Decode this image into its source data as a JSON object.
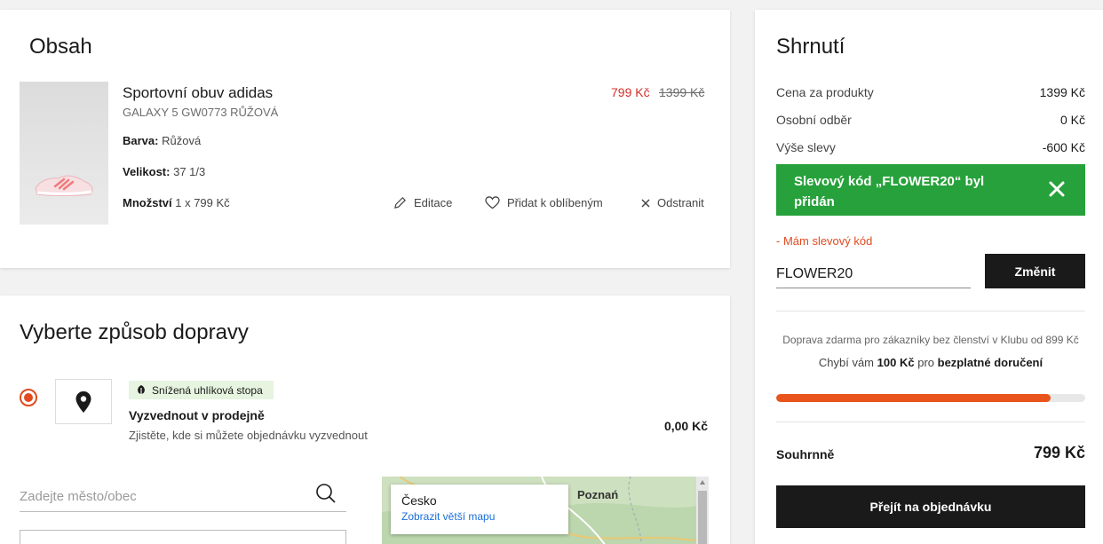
{
  "cart": {
    "title": "Obsah",
    "item": {
      "name": "Sportovní obuv adidas",
      "subtitle": "GALAXY 5 GW0773 RŮŽOVÁ",
      "color_label": "Barva:",
      "color_value": "Růžová",
      "size_label": "Velikost:",
      "size_value": "37 1/3",
      "qty_label": "Množství",
      "qty_value": "1 x 799 Kč",
      "price_new": "799 Kč",
      "price_old": "1399 Kč",
      "edit_label": "Editace",
      "favorite_label": "Přidat k oblíbeným",
      "remove_label": "Odstranit"
    }
  },
  "delivery": {
    "title": "Vyberte způsob dopravy",
    "option": {
      "badge": "Snížená uhlíková stopa",
      "name": "Vyzvednout v prodejně",
      "description": "Zjistěte, kde si můžete objednávku vyzvednout",
      "price": "0,00 Kč"
    },
    "search_placeholder": "Zadejte město/obec",
    "map": {
      "popup_title": "Česko",
      "popup_link": "Zobrazit větší mapu",
      "city_labels": [
        "Poznań"
      ]
    }
  },
  "summary": {
    "title": "Shrnutí",
    "rows": [
      {
        "label": "Cena za produkty",
        "value": "1399 Kč"
      },
      {
        "label": "Osobní odběr",
        "value": "0 Kč"
      },
      {
        "label": "Výše slevy",
        "value": "-600 Kč"
      }
    ],
    "promo_applied": "Slevový kód „FLOWER20“ byl přidán",
    "have_code_label": "- Mám slevový kód",
    "code_value": "FLOWER20",
    "change_button": "Změnit",
    "shipping_note": "Doprava zdarma pro zákazníky bez členství v Klubu od 899 Kč",
    "missing_prefix": "Chybí vám",
    "missing_amount": "100",
    "missing_currency": "Kč",
    "missing_mid": "pro",
    "missing_suffix": "bezplatné doručení",
    "progress_fraction": 0.889,
    "total_label": "Souhrnně",
    "total_value": "799 Kč",
    "checkout_button": "Přejít na objednávku"
  },
  "colors": {
    "accent_orange": "#e14a1f",
    "success_green": "#27a13b",
    "price_red": "#d0302a",
    "dark_button": "#1a1a1a"
  },
  "icons": [
    "pencil-icon",
    "heart-icon",
    "close-icon",
    "location-pin-icon",
    "leaf-icon",
    "search-icon"
  ]
}
